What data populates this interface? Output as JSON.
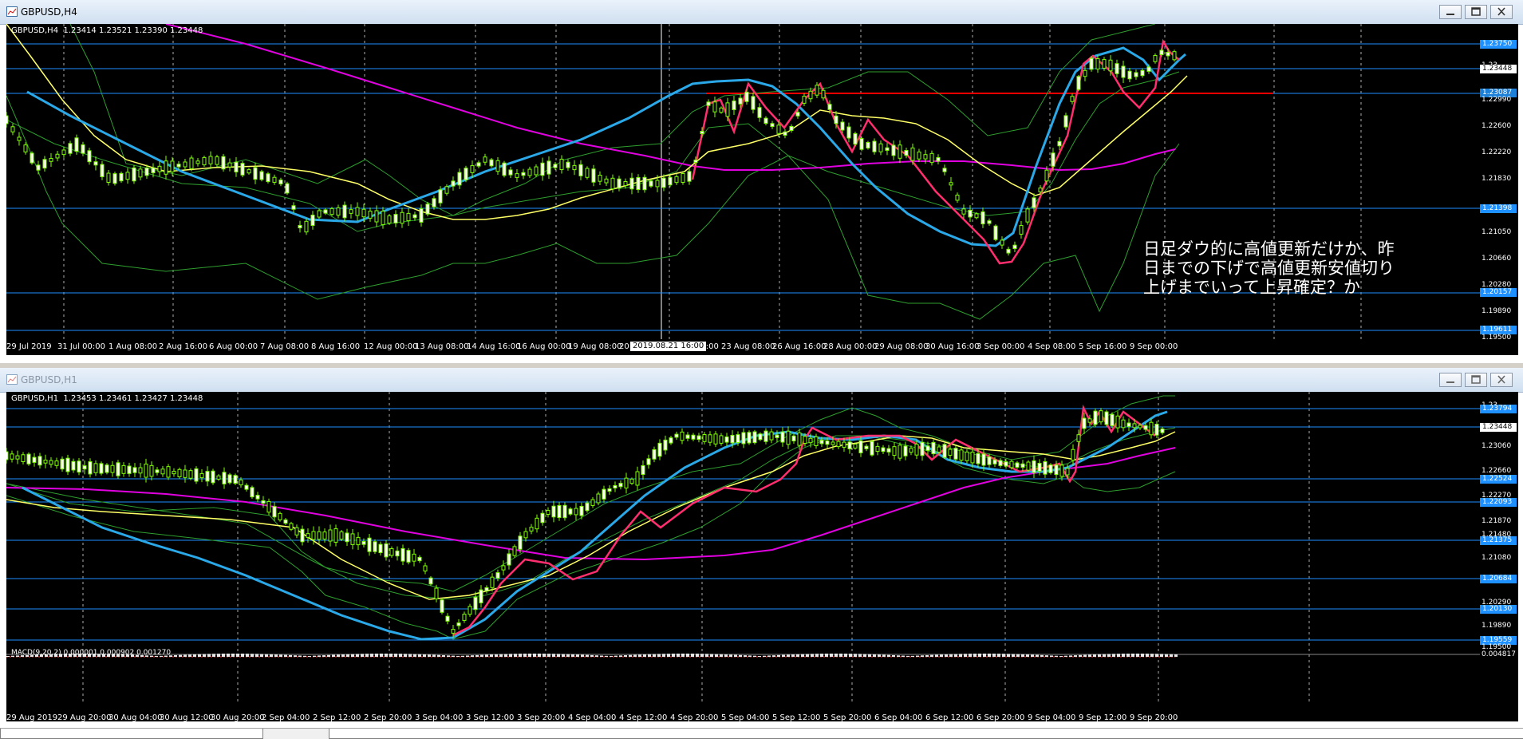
{
  "windows": [
    {
      "title": "GBPUSD,H4",
      "symbol_info": "GBPUSD,H4  1.23414 1.23521 1.23390 1.23448",
      "x_labels": [
        "29 Jul 2019",
        "31 Jul 00:00",
        "1 Aug 08:00",
        "2 Aug 16:00",
        "6 Aug 00:00",
        "7 Aug 08:00",
        "8 Aug 16:00",
        "12 Aug 00:00",
        "13 Aug 08:00",
        "14 Aug 16:00",
        "16 Aug 00:00",
        "19 Aug 08:00",
        "20",
        "00:00",
        "23 Aug 08:00",
        "26 Aug 16:00",
        "28 Aug 00:00",
        "29 Aug 08:00",
        "30 Aug 16:00",
        "3 Sep 00:00",
        "4 Sep 08:00",
        "5 Sep 16:00",
        "9 Sep 00:00"
      ],
      "crosshair_label": "2019.08.21 16:00",
      "y_labels": [
        "1.22990",
        "1.22600",
        "1.22220",
        "1.21830",
        "1.21050",
        "1.20660",
        "1.20280",
        "1.19890",
        "1.19500"
      ],
      "levels": [
        "1.23750",
        "1.23087",
        "1.21398",
        "1.20157",
        "1.19611"
      ],
      "current_price": "1.23448",
      "partial_label": "1.23",
      "annotation": "日足ダウ的に高値更新だけか、昨\n日までの下げで高値更新安値切り\n上げまでいって上昇確定？か",
      "window_buttons": [
        "minimize-button",
        "maximize-button",
        "close-button"
      ]
    },
    {
      "title": "GBPUSD,H1",
      "symbol_info": "GBPUSD,H1  1.23453 1.23461 1.23427 1.23448",
      "x_labels": [
        "29 Aug 2019",
        "29 Aug 20:00",
        "30 Aug 04:00",
        "30 Aug 12:00",
        "30 Aug 20:00",
        "2 Sep 04:00",
        "2 Sep 12:00",
        "2 Sep 20:00",
        "3 Sep 04:00",
        "3 Sep 12:00",
        "3 Sep 20:00",
        "4 Sep 04:00",
        "4 Sep 12:00",
        "4 Sep 20:00",
        "5 Sep 04:00",
        "5 Sep 12:00",
        "5 Sep 20:00",
        "6 Sep 04:00",
        "6 Sep 12:00",
        "6 Sep 20:00",
        "9 Sep 04:00",
        "9 Sep 12:00",
        "9 Sep 20:00"
      ],
      "y_labels": [
        "1.23060",
        "1.22660",
        "1.22270",
        "1.21870",
        "1.21480",
        "1.21080",
        "1.20290",
        "1.19890",
        "1.19500",
        "0.004817"
      ],
      "levels": [
        "1.23794",
        "1.22524",
        "1.22093",
        "1.21375",
        "1.20684",
        "1.20130",
        "1.19559"
      ],
      "current_price": "1.23448",
      "top_label": "1.23",
      "macd_label": "MACD(9,20,2) 0.000001 0.000902 0.001270",
      "window_buttons": [
        "minimize-button",
        "maximize-button",
        "close-button"
      ]
    }
  ],
  "colors": {
    "background": "#000000",
    "grid": "#ffffff",
    "level_line": "#1e90ff",
    "resistance_line": "#ff0000",
    "ma_fast": "#ffff66",
    "ma_slow": "#e000e0",
    "ma_blue": "#2aa8e8",
    "zigzag": "#ff2e6e",
    "bollinger": "#2e9e2e",
    "candle": "#7fff00"
  }
}
